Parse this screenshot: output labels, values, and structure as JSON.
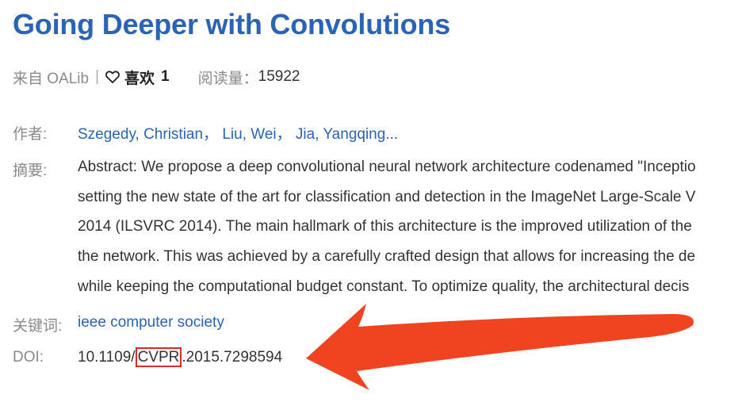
{
  "title": "Going Deeper with Convolutions",
  "meta": {
    "source": "来自 OALib",
    "separator": "|",
    "like_label": "喜欢",
    "like_count": "1",
    "views_label": "阅读量：",
    "views_count": "15922"
  },
  "authors": {
    "label": "作者:",
    "list": [
      {
        "name": "Szegedy, Christian，"
      },
      {
        "name": "Liu, Wei，"
      },
      {
        "name": "Jia, Yangqing..."
      }
    ]
  },
  "abstract": {
    "label": "摘要:",
    "lines": [
      "Abstract: We propose a deep convolutional neural network architecture codenamed \"Inceptio",
      "setting the new state of the art for classification and detection in the ImageNet Large-Scale V",
      "2014 (ILSVRC 2014). The main hallmark of this architecture is the improved utilization of the",
      "the network. This was achieved by a carefully crafted design that allows for increasing the de",
      "while keeping the computational budget constant. To optimize quality, the architectural decis"
    ]
  },
  "keywords": {
    "label": "关键词:",
    "value": "ieee computer society"
  },
  "doi": {
    "label": "DOI:",
    "prefix": "10.1109/",
    "highlight": "CVPR",
    "suffix": ".2015.7298594"
  },
  "colors": {
    "title_link": "#2b63b5",
    "arrow": "#f0431f",
    "highlight_box": "#e02a2a"
  },
  "icons": {
    "like": "heart-outline-icon",
    "annotation": "arrow-left-annotation"
  }
}
